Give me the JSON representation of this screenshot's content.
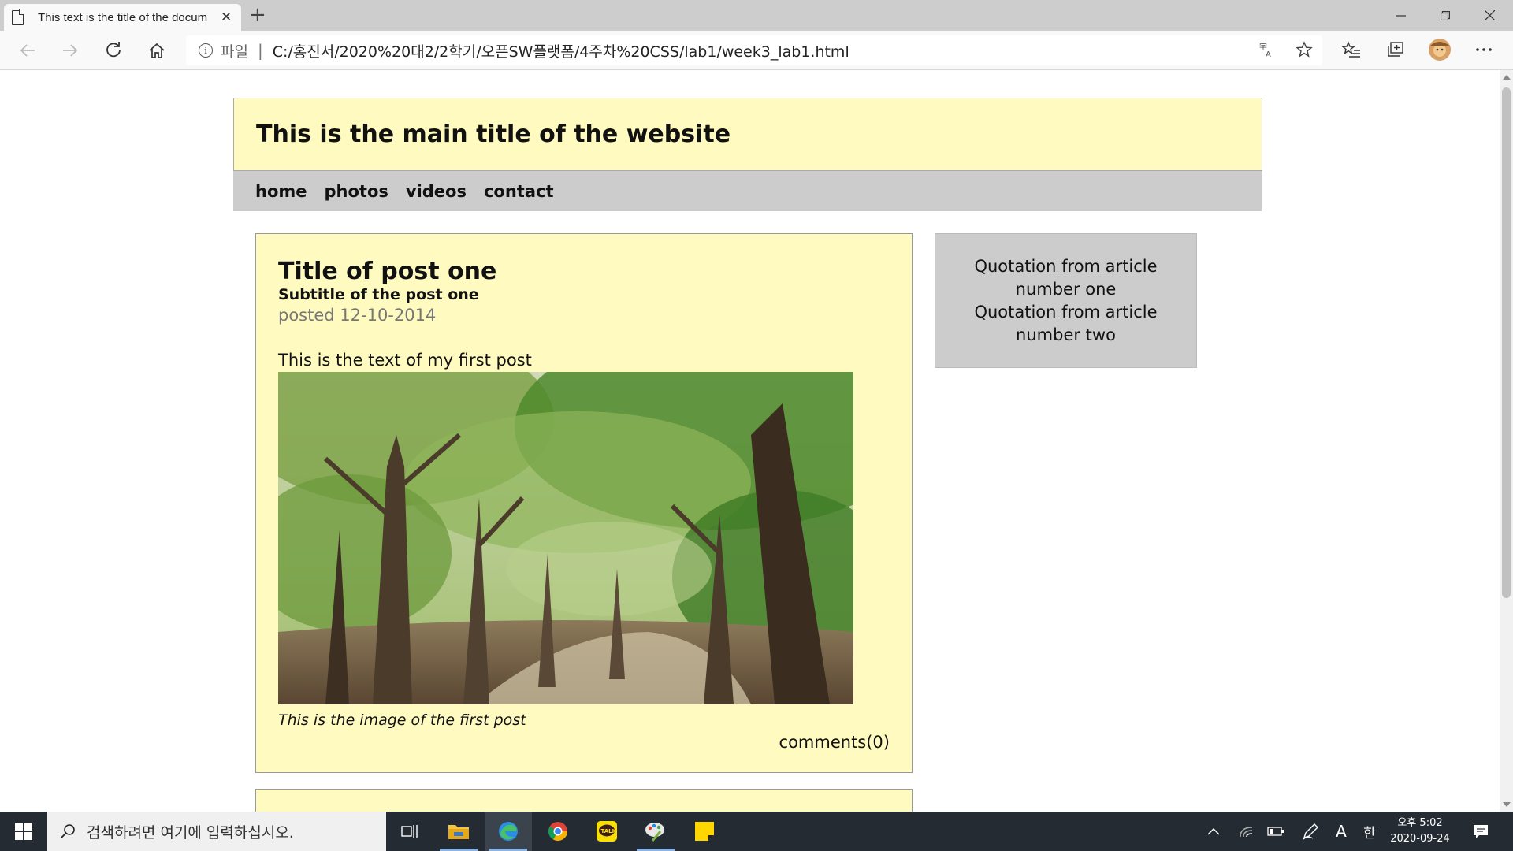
{
  "browser": {
    "tab_title": "This text is the title of the docum",
    "address_scheme": "파일",
    "address_separator": "|",
    "url": "C:/홍진서/2020%20대2/2학기/오픈SW플랫폼/4주차%20CSS/lab1/week3_lab1.html"
  },
  "site": {
    "main_title": "This is the main title of the website",
    "nav": [
      "home",
      "photos",
      "videos",
      "contact"
    ]
  },
  "post": {
    "title": "Title of post one",
    "subtitle": "Subtitle of the post one",
    "posted": "posted 12-10-2014",
    "text": "This is the text of my first post",
    "caption": "This is the image of the first post",
    "comments": "comments(0)"
  },
  "aside": {
    "quote1": "Quotation from article number one",
    "quote2": "Quotation from article number two"
  },
  "taskbar": {
    "search_placeholder": "검색하려면 여기에 입력하십시오.",
    "ime_letter": "A",
    "ime_lang": "한",
    "time": "오후 5:02",
    "date": "2020-09-24"
  },
  "colors": {
    "header_bg": "#fffac0",
    "nav_bg": "#cccccc",
    "taskbar_bg": "#242b33"
  }
}
